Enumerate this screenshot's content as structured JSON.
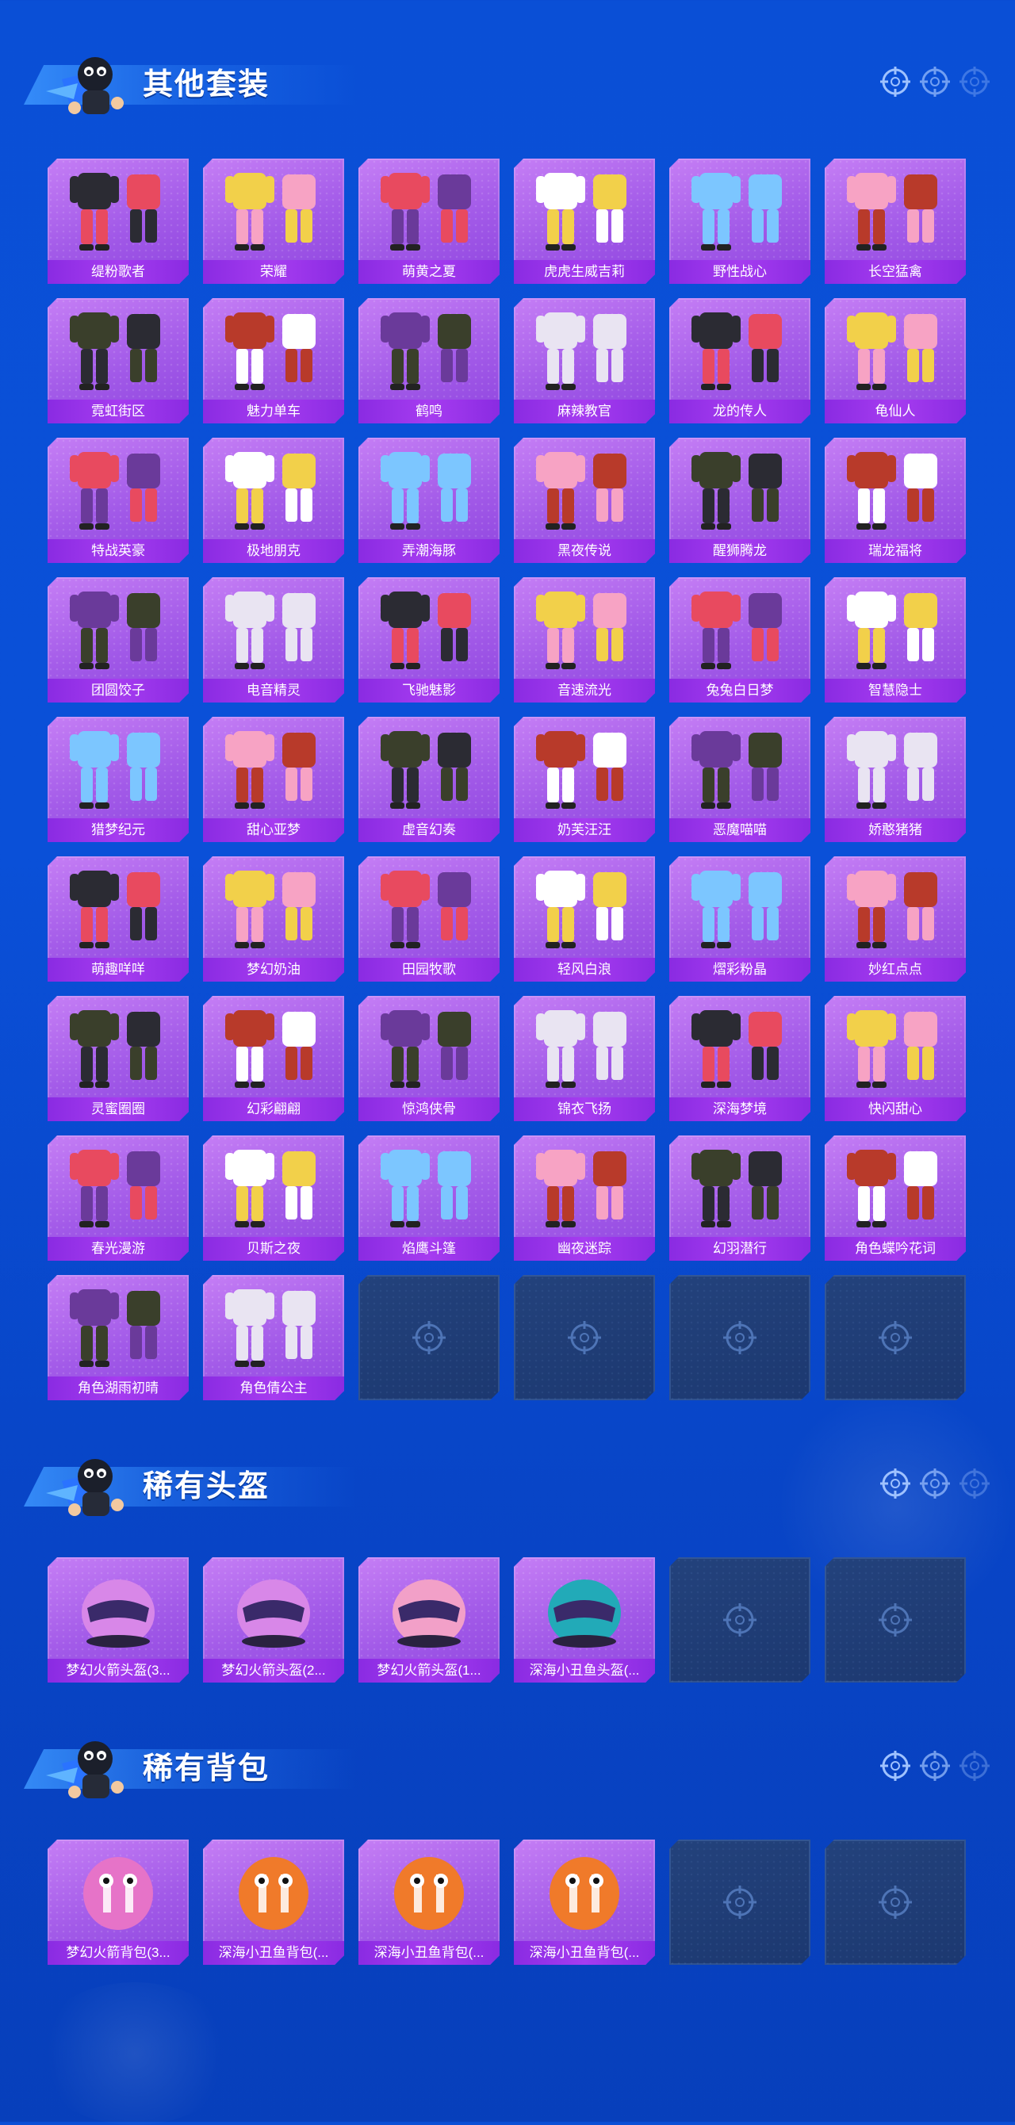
{
  "sections": [
    {
      "title": "其他套装",
      "items": [
        "缇粉歌者",
        "荣耀",
        "萌黄之夏",
        "虎虎生威吉莉",
        "野性战心",
        "长空猛禽",
        "霓虹街区",
        "魅力单车",
        "鹤鸣",
        "麻辣教官",
        "龙的传人",
        "龟仙人",
        "特战英豪",
        "极地朋克",
        "弄潮海豚",
        "黑夜传说",
        "醒狮腾龙",
        "瑞龙福将",
        "团圆饺子",
        "电音精灵",
        "飞驰魅影",
        "音速流光",
        "兔兔白日梦",
        "智慧隐士",
        "猎梦纪元",
        "甜心亚梦",
        "虚音幻奏",
        "奶芙汪汪",
        "恶魔喵喵",
        "娇憨猪猪",
        "萌趣咩咩",
        "梦幻奶油",
        "田园牧歌",
        "轻风白浪",
        "熠彩粉晶",
        "妙红点点",
        "灵蜜圈圈",
        "幻彩翩翩",
        "惊鸿侠骨",
        "锦衣飞扬",
        "深海梦境",
        "快闪甜心",
        "春光漫游",
        "贝斯之夜",
        "焰鹰斗篷",
        "幽夜迷踪",
        "幻羽潜行",
        "角色蝶吟花词",
        "角色湖雨初晴",
        "角色倩公主"
      ],
      "empty_slots": 4
    },
    {
      "title": "稀有头盔",
      "items": [
        "梦幻火箭头盔(3...",
        "梦幻火箭头盔(2...",
        "梦幻火箭头盔(1...",
        "深海小丑鱼头盔(..."
      ],
      "empty_slots": 2
    },
    {
      "title": "稀有背包",
      "items": [
        "梦幻火箭背包(3...",
        "深海小丑鱼背包(...",
        "深海小丑鱼背包(...",
        "深海小丑鱼背包(..."
      ],
      "empty_slots": 2
    }
  ],
  "icons": {
    "mascot": "mascot-icon",
    "reticle": "crosshair-icon"
  },
  "colors": {
    "background": "#0a4fd6",
    "card": "#a25ae8",
    "card_label": "#8a2be2",
    "empty_card": "#1f3c75"
  }
}
